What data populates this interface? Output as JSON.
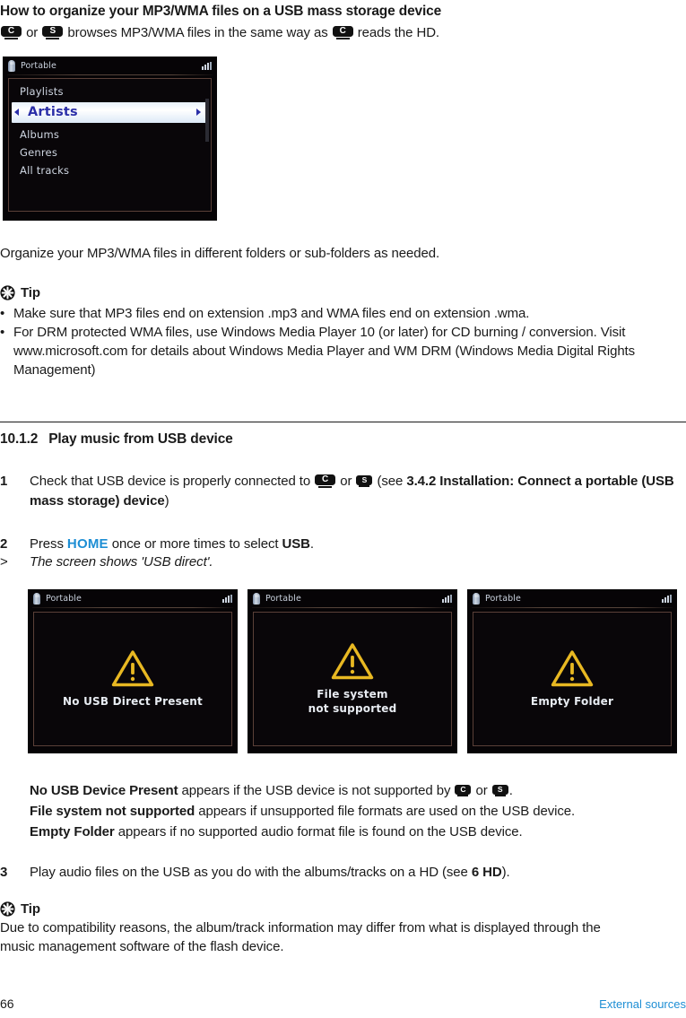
{
  "header": {
    "title": "How to organize your MP3/WMA files on a USB mass storage device",
    "intro_pre": "",
    "intro_mid": " or ",
    "intro_post": " browses MP3/WMA files in the same way as ",
    "intro_tail": " reads the HD.",
    "badge_c": "C",
    "badge_s": "S"
  },
  "device_screen_1": {
    "title": "Portable",
    "items": [
      {
        "label": "Playlists",
        "highlighted": false
      },
      {
        "label": "Artists",
        "highlighted": true
      },
      {
        "label": "Albums",
        "highlighted": false
      },
      {
        "label": "Genres",
        "highlighted": false
      },
      {
        "label": "All tracks",
        "highlighted": false
      }
    ]
  },
  "organize_line": "Organize your MP3/WMA files in different folders or sub-folders as needed.",
  "tip1": {
    "label": "Tip",
    "bullets": [
      "Make sure that MP3 files end on extension .mp3 and WMA files end on extension .wma.",
      "For DRM protected WMA files, use Windows Media Player 10 (or later) for CD burning / conversion. Visit www.microsoft.com for details about Windows Media Player and WM DRM (Windows Media Digital Rights Management)"
    ]
  },
  "section": {
    "number": "10.1.2",
    "title": "Play music from USB device"
  },
  "steps": {
    "step1": {
      "num": "1",
      "part1": "Check that USB device is properly connected to ",
      "or": " or ",
      "part2": " (see ",
      "bold_ref": "3.4.2 Installation: Connect a portable (USB mass storage) device",
      "part3": ")"
    },
    "step2": {
      "num": "2",
      "part1": "Press ",
      "key": "HOME",
      "part2": " once or more times to select ",
      "bold_usb": "USB",
      "part3": ".",
      "result_marker": ">",
      "result": "The screen shows 'USB direct'."
    },
    "step3": {
      "num": "3",
      "part1": "Play audio files on the USB as you do with the albums/tracks on a HD (see ",
      "bold_ref": "6 HD",
      "part2": ")."
    }
  },
  "error_screens": [
    {
      "title": "Portable",
      "message_lines": [
        "No USB Direct Present"
      ]
    },
    {
      "title": "Portable",
      "message_lines": [
        "File system",
        "not supported"
      ]
    },
    {
      "title": "Portable",
      "message_lines": [
        "Empty Folder"
      ]
    }
  ],
  "error_explanations": [
    {
      "bold": "No USB Device Present",
      "mid": " appears if the USB device is not supported by ",
      "or": " or ",
      "tail": "."
    },
    {
      "bold": "File system not supported",
      "rest": " appears if unsupported file formats are used on the USB device."
    },
    {
      "bold": "Empty Folder",
      "rest": " appears if no supported audio format file is found on the USB device."
    }
  ],
  "tip2": {
    "label": "Tip",
    "text": "Due to compatibility reasons, the album/track information may differ from what is displayed through the music management software of the flash device."
  },
  "footer": {
    "page_number": "66",
    "section_name": "External sources"
  },
  "colors": {
    "accent_blue": "#1d8ed4",
    "warning_yellow": "#e8b822",
    "highlight_text": "#2b2fa8"
  }
}
